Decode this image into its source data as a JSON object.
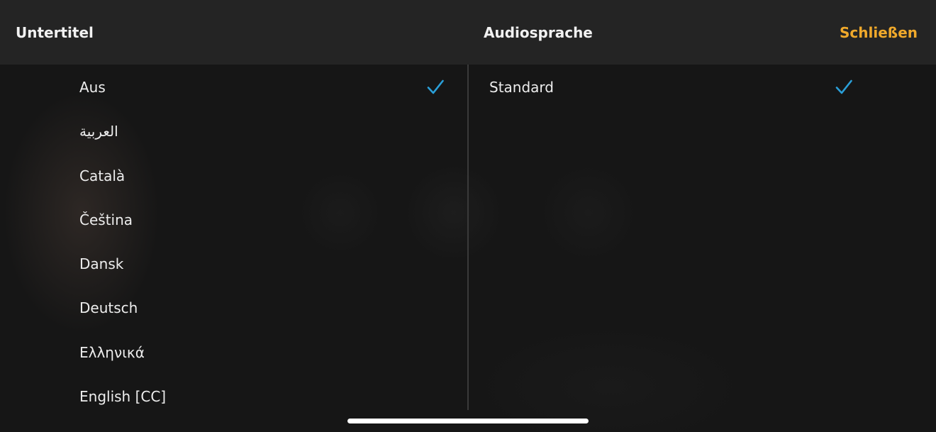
{
  "header": {
    "subtitles_title": "Untertitel",
    "audio_title": "Audiosprache",
    "close_label": "Schließen"
  },
  "subtitles": {
    "items": [
      {
        "label": "Aus",
        "selected": true
      },
      {
        "label": "العربية",
        "selected": false
      },
      {
        "label": "Català",
        "selected": false
      },
      {
        "label": "Čeština",
        "selected": false
      },
      {
        "label": "Dansk",
        "selected": false
      },
      {
        "label": "Deutsch",
        "selected": false
      },
      {
        "label": "Ελληνικά",
        "selected": false
      },
      {
        "label": "English [CC]",
        "selected": false
      }
    ]
  },
  "audio": {
    "items": [
      {
        "label": "Standard",
        "selected": true
      }
    ]
  },
  "icons": {
    "selected": "checkmark-icon"
  },
  "colors": {
    "accent": "#f0a92b",
    "check": "#2a9fd8",
    "text": "#ededed",
    "header_bg": "#242424"
  }
}
